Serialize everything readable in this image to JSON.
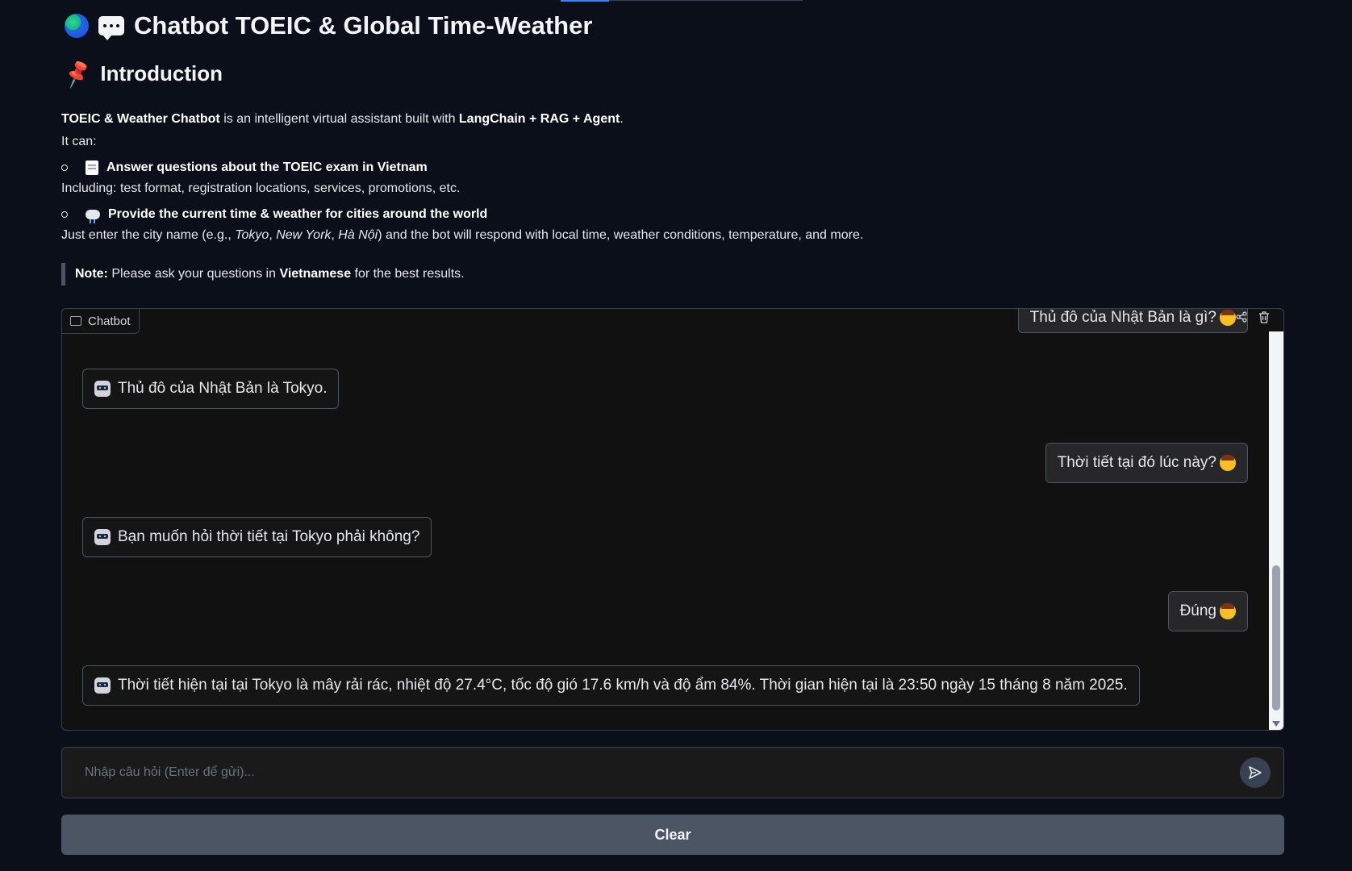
{
  "header": {
    "title": "Chatbot TOEIC & Global Time-Weather",
    "section_title": "Introduction"
  },
  "intro": {
    "app_name": "TOEIC & Weather Chatbot",
    "built_with_prefix": " is an intelligent virtual assistant built with ",
    "stack": "LangChain + RAG + Agent",
    "period": ".",
    "it_can": "It can:",
    "bullet1_title": "Answer questions about the TOEIC exam in Vietnam",
    "bullet1_detail": "Including: test format, registration locations, services, promotions, etc.",
    "bullet2_title": "Provide the current time & weather for cities around the world",
    "bullet2_detail_prefix": "Just enter the city name (e.g., ",
    "city1": "Tokyo",
    "comma1": ", ",
    "city2": "New York",
    "comma2": ", ",
    "city3": "Hà Nội",
    "bullet2_detail_suffix": ") and the bot will respond with local time, weather conditions, temperature, and more.",
    "note_label": "Note:",
    "note_prefix": " Please ask your questions in ",
    "note_language": "Vietnamese",
    "note_suffix": " for the best results."
  },
  "chatbot": {
    "label": "Chatbot",
    "messages": [
      {
        "role": "user",
        "text": "Thủ đô của Nhật Bản là gì?"
      },
      {
        "role": "bot",
        "text": "Thủ đô của Nhật Bản là Tokyo."
      },
      {
        "role": "user",
        "text": "Thời tiết tại đó lúc này?"
      },
      {
        "role": "bot",
        "text": "Bạn muốn hỏi thời tiết tại Tokyo phải không?"
      },
      {
        "role": "user",
        "text": "Đúng"
      },
      {
        "role": "bot",
        "text": "Thời tiết hiện tại tại Tokyo là mây rải rác, nhiệt độ 27.4°C, tốc độ gió 17.6 km/h và độ ẩm 84%. Thời gian hiện tại là 23:50 ngày 15 tháng 8 năm 2025."
      }
    ]
  },
  "input": {
    "placeholder": "Nhập câu hỏi (Enter để gửi)...",
    "value": ""
  },
  "buttons": {
    "clear": "Clear"
  },
  "colors": {
    "background": "#0b0f19",
    "panel": "#111111",
    "border": "#374151",
    "clear_button": "#4b5563",
    "accent": "#3b82f6"
  },
  "icons": [
    "globe-icon",
    "speech-bubble-icon",
    "pushpin-icon",
    "memo-icon",
    "cloud-rain-icon",
    "chat-icon",
    "bot-avatar-icon",
    "user-avatar-icon",
    "share-icon",
    "trash-icon",
    "send-icon"
  ]
}
